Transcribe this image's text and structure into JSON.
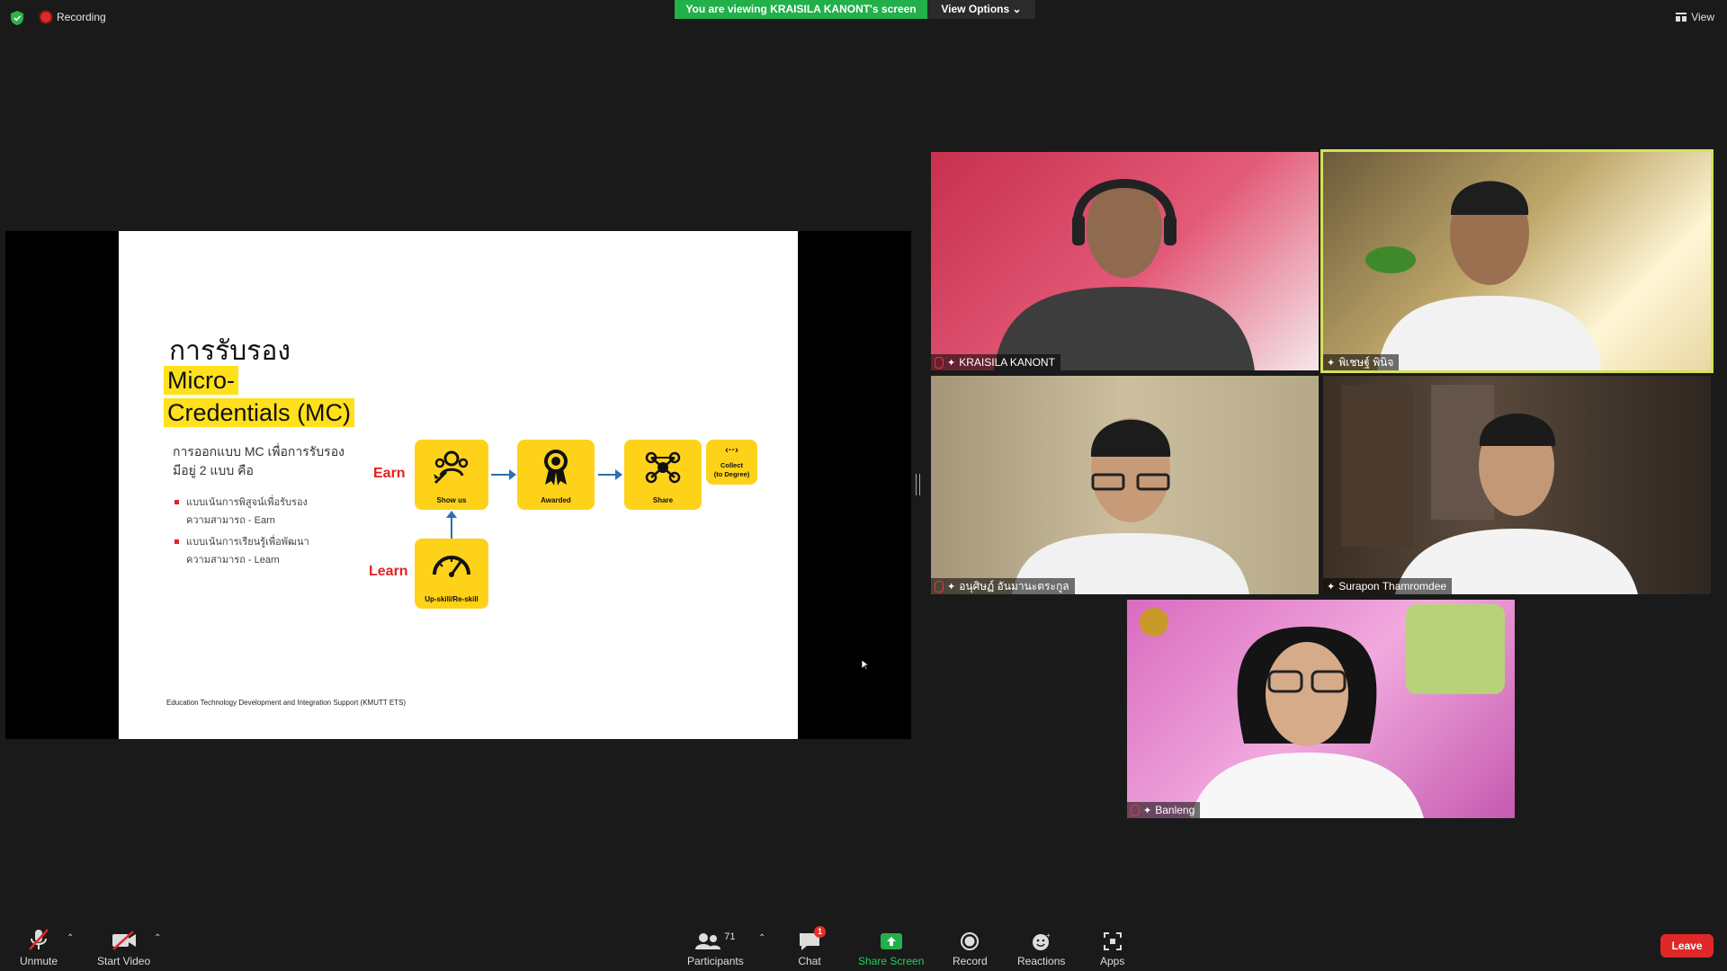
{
  "topbar": {
    "recording_label": "Recording",
    "banner_text": "You are viewing KRAISILA KANONT's screen",
    "view_options_label": "View Options",
    "view_label": "View"
  },
  "slide": {
    "title_thai": "การรับรอง",
    "title_line1": "Micro-",
    "title_line2": "Credentials (MC)",
    "intro_line1": "การออกแบบ MC เพื่อการรับรอง",
    "intro_line2": "มีอยู่ 2 แบบ คือ",
    "bullets": [
      {
        "line1": "แบบเน้นการพิสูจน์เพื่อรับรอง",
        "line2": "ความสามารถ - Earn"
      },
      {
        "line1": "แบบเน้นการเรียนรู้เพื่อพัฒนา",
        "line2": "ความสามารถ - Learn"
      }
    ],
    "earn_label": "Earn",
    "learn_label": "Learn",
    "boxes": {
      "show_us": "Show us",
      "awarded": "Awarded",
      "share": "Share",
      "collect_line1": "Collect",
      "collect_line2": "(to Degree)",
      "upskill": "Up-skill/Re-skill"
    },
    "footer": "Education Technology Development and Integration Support (KMUTT ETS)"
  },
  "participants": [
    {
      "name": "KRAISILA KANONT",
      "muted": true
    },
    {
      "name": "พิเชษฐ์ พินิจ",
      "muted": false,
      "active_speaker": true
    },
    {
      "name": "อนุศิษฏ์ อันมานะตระกูล",
      "muted": true
    },
    {
      "name": "Surapon Thamromdee",
      "muted": false
    },
    {
      "name": "Banleng",
      "muted": true
    }
  ],
  "toolbar": {
    "unmute": "Unmute",
    "start_video": "Start Video",
    "participants": "Participants",
    "participants_count": "71",
    "chat": "Chat",
    "chat_badge": "1",
    "share_screen": "Share Screen",
    "record": "Record",
    "reactions": "Reactions",
    "apps": "Apps",
    "leave": "Leave"
  },
  "colors": {
    "banner_green": "#21b04a",
    "accent_yellow": "#ffd21a",
    "leave_red": "#e02828",
    "active_speaker_border": "#d4e157"
  }
}
